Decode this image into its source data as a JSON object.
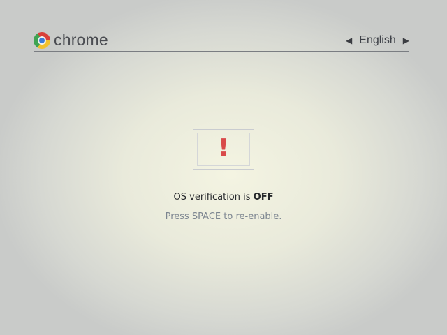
{
  "header": {
    "brand": "chrome",
    "brand_icon": "chrome-logo-icon",
    "language": {
      "label": "English",
      "prev_icon": "◀",
      "next_icon": "▶"
    }
  },
  "main": {
    "warning_icon": "!",
    "message_prefix": "OS verification is ",
    "message_status": "OFF",
    "hint": "Press SPACE to re-enable."
  },
  "colors": {
    "warning": "#d94a4a",
    "text": "#26282b",
    "hint": "#7c8590"
  }
}
